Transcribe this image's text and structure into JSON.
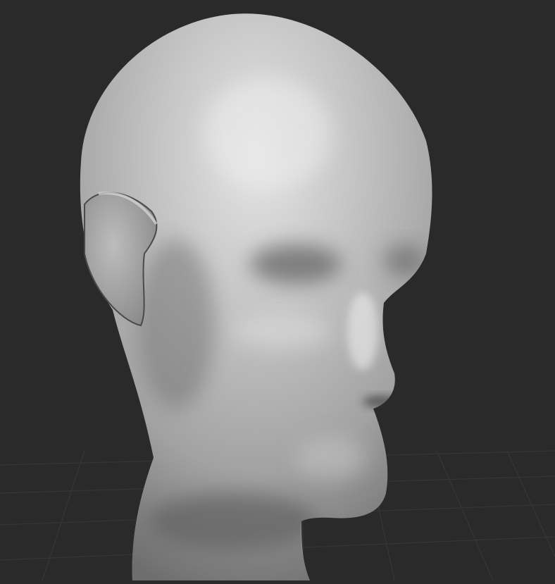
{
  "viewport": {
    "background_color": "#2a2a2a",
    "grid_color": "#363636",
    "model_base_color": "#a8a8a8",
    "model_highlight_color": "#e6e6e6",
    "model_shadow_color": "#5a5a5a"
  }
}
